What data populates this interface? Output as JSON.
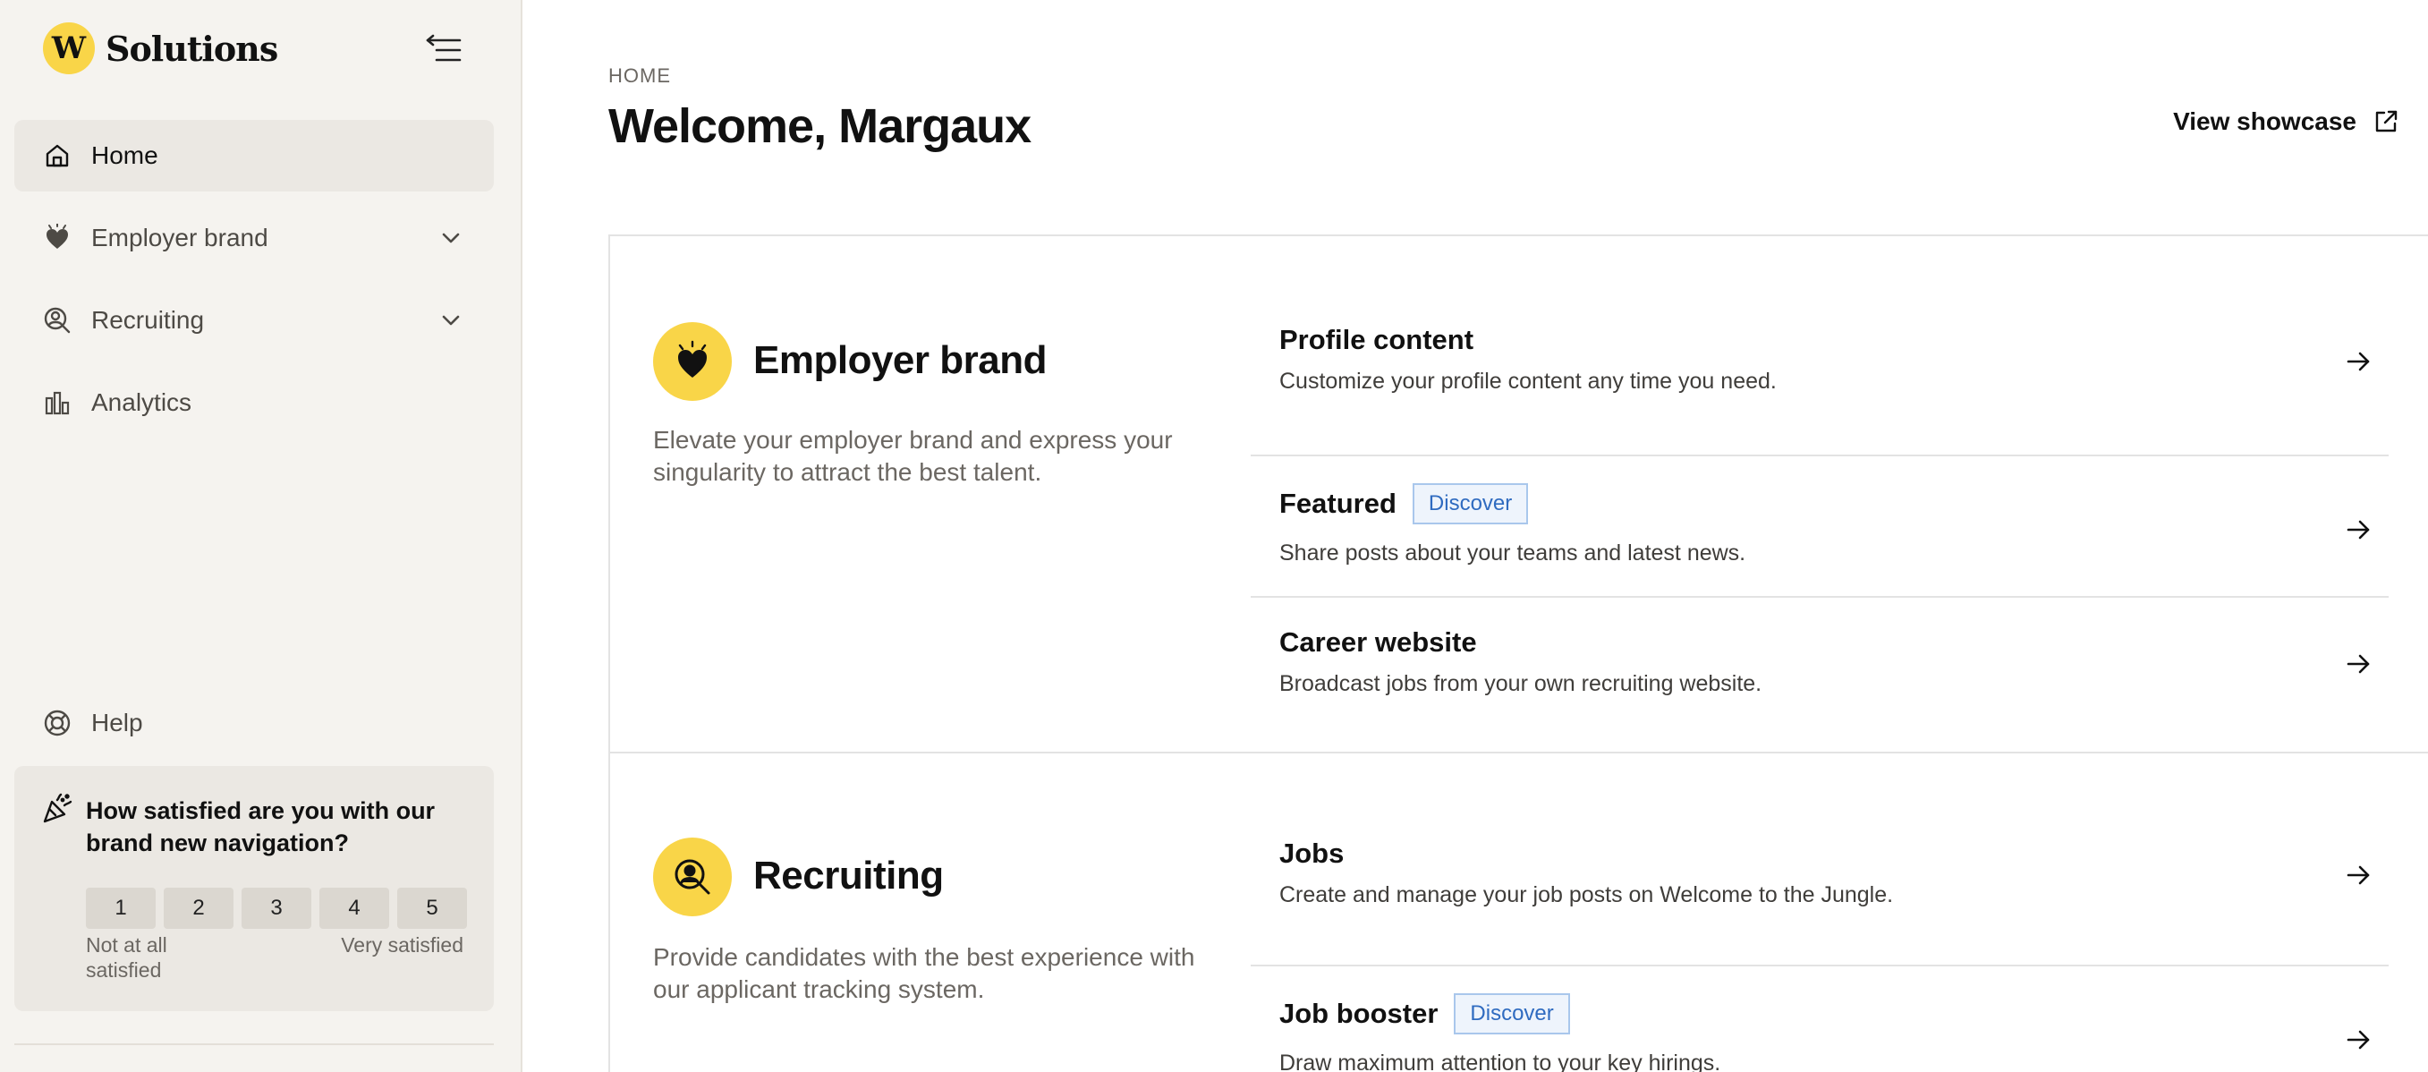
{
  "brand": {
    "logo_letter": "W",
    "name": "Solutions",
    "accent": "#f9d548"
  },
  "sidebar": {
    "items": [
      {
        "label": "Home",
        "icon": "home-icon",
        "active": true
      },
      {
        "label": "Employer brand",
        "icon": "heart-icon",
        "expandable": true
      },
      {
        "label": "Recruiting",
        "icon": "person-search-icon",
        "expandable": true
      },
      {
        "label": "Analytics",
        "icon": "bar-chart-icon"
      }
    ],
    "help_label": "Help"
  },
  "survey": {
    "question": "How satisfied are you with our brand new navigation?",
    "ratings": [
      "1",
      "2",
      "3",
      "4",
      "5"
    ],
    "low_label": "Not at all satisfied",
    "high_label": "Very satisfied"
  },
  "header": {
    "breadcrumb": "HOME",
    "title": "Welcome, Margaux",
    "showcase_label": "View showcase"
  },
  "sections": [
    {
      "title": "Employer brand",
      "description": "Elevate your employer brand and express your singularity to attract the best talent.",
      "features": [
        {
          "name": "Profile content",
          "description": "Customize your profile content any time you need."
        },
        {
          "name": "Featured",
          "badge": "Discover",
          "description": "Share posts about your teams and latest news."
        },
        {
          "name": "Career website",
          "description": "Broadcast jobs from your own recruiting website."
        }
      ]
    },
    {
      "title": "Recruiting",
      "description": "Provide candidates with the best experience with our applicant tracking system.",
      "features": [
        {
          "name": "Jobs",
          "description": "Create and manage your job posts on Welcome to the Jungle."
        },
        {
          "name": "Job booster",
          "badge": "Discover",
          "description": "Draw maximum attention to your key hirings."
        }
      ]
    }
  ]
}
